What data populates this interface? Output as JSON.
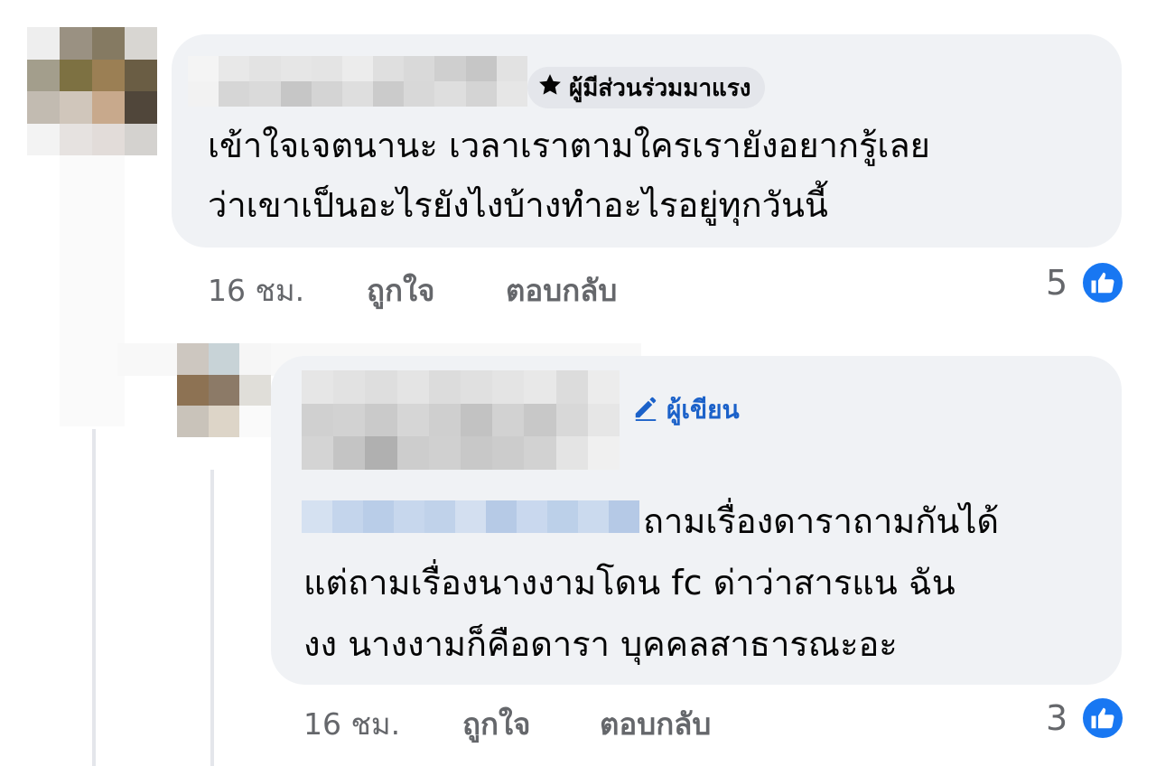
{
  "comment": {
    "badge_label": "ผู้มีส่วนร่วมมาแรง",
    "badge_icon": "star-icon",
    "text_line1": "เข้าใจเจตนานะ เวลาเราตามใครเรายังอยากรู้เลย",
    "text_line2": "ว่าเขาเป็นอะไรยังไงบ้างทำอะไรอยู่ทุกวันนี้",
    "time": "16 ชม.",
    "like_action": "ถูกใจ",
    "reply_action": "ตอบกลับ",
    "like_count": "5"
  },
  "reply": {
    "author_badge": "ผู้เขียน",
    "author_badge_icon": "pencil-icon",
    "text_line1": "ถามเรื่องดาราถามกันได้",
    "text_line2": "แต่ถามเรื่องนางงามโดน fc ด่าว่าสารแน ฉัน",
    "text_line3": "งง นางงามก็คือดารา บุคคลสาธารณะอะ",
    "time": "16 ชม.",
    "like_action": "ถูกใจ",
    "reply_action": "ตอบกลับ",
    "like_count": "3"
  },
  "colors": {
    "bubble": "#f0f2f5",
    "meta_text": "#65676b",
    "like_blue": "#1877f2",
    "author_blue": "#1b61c9"
  }
}
